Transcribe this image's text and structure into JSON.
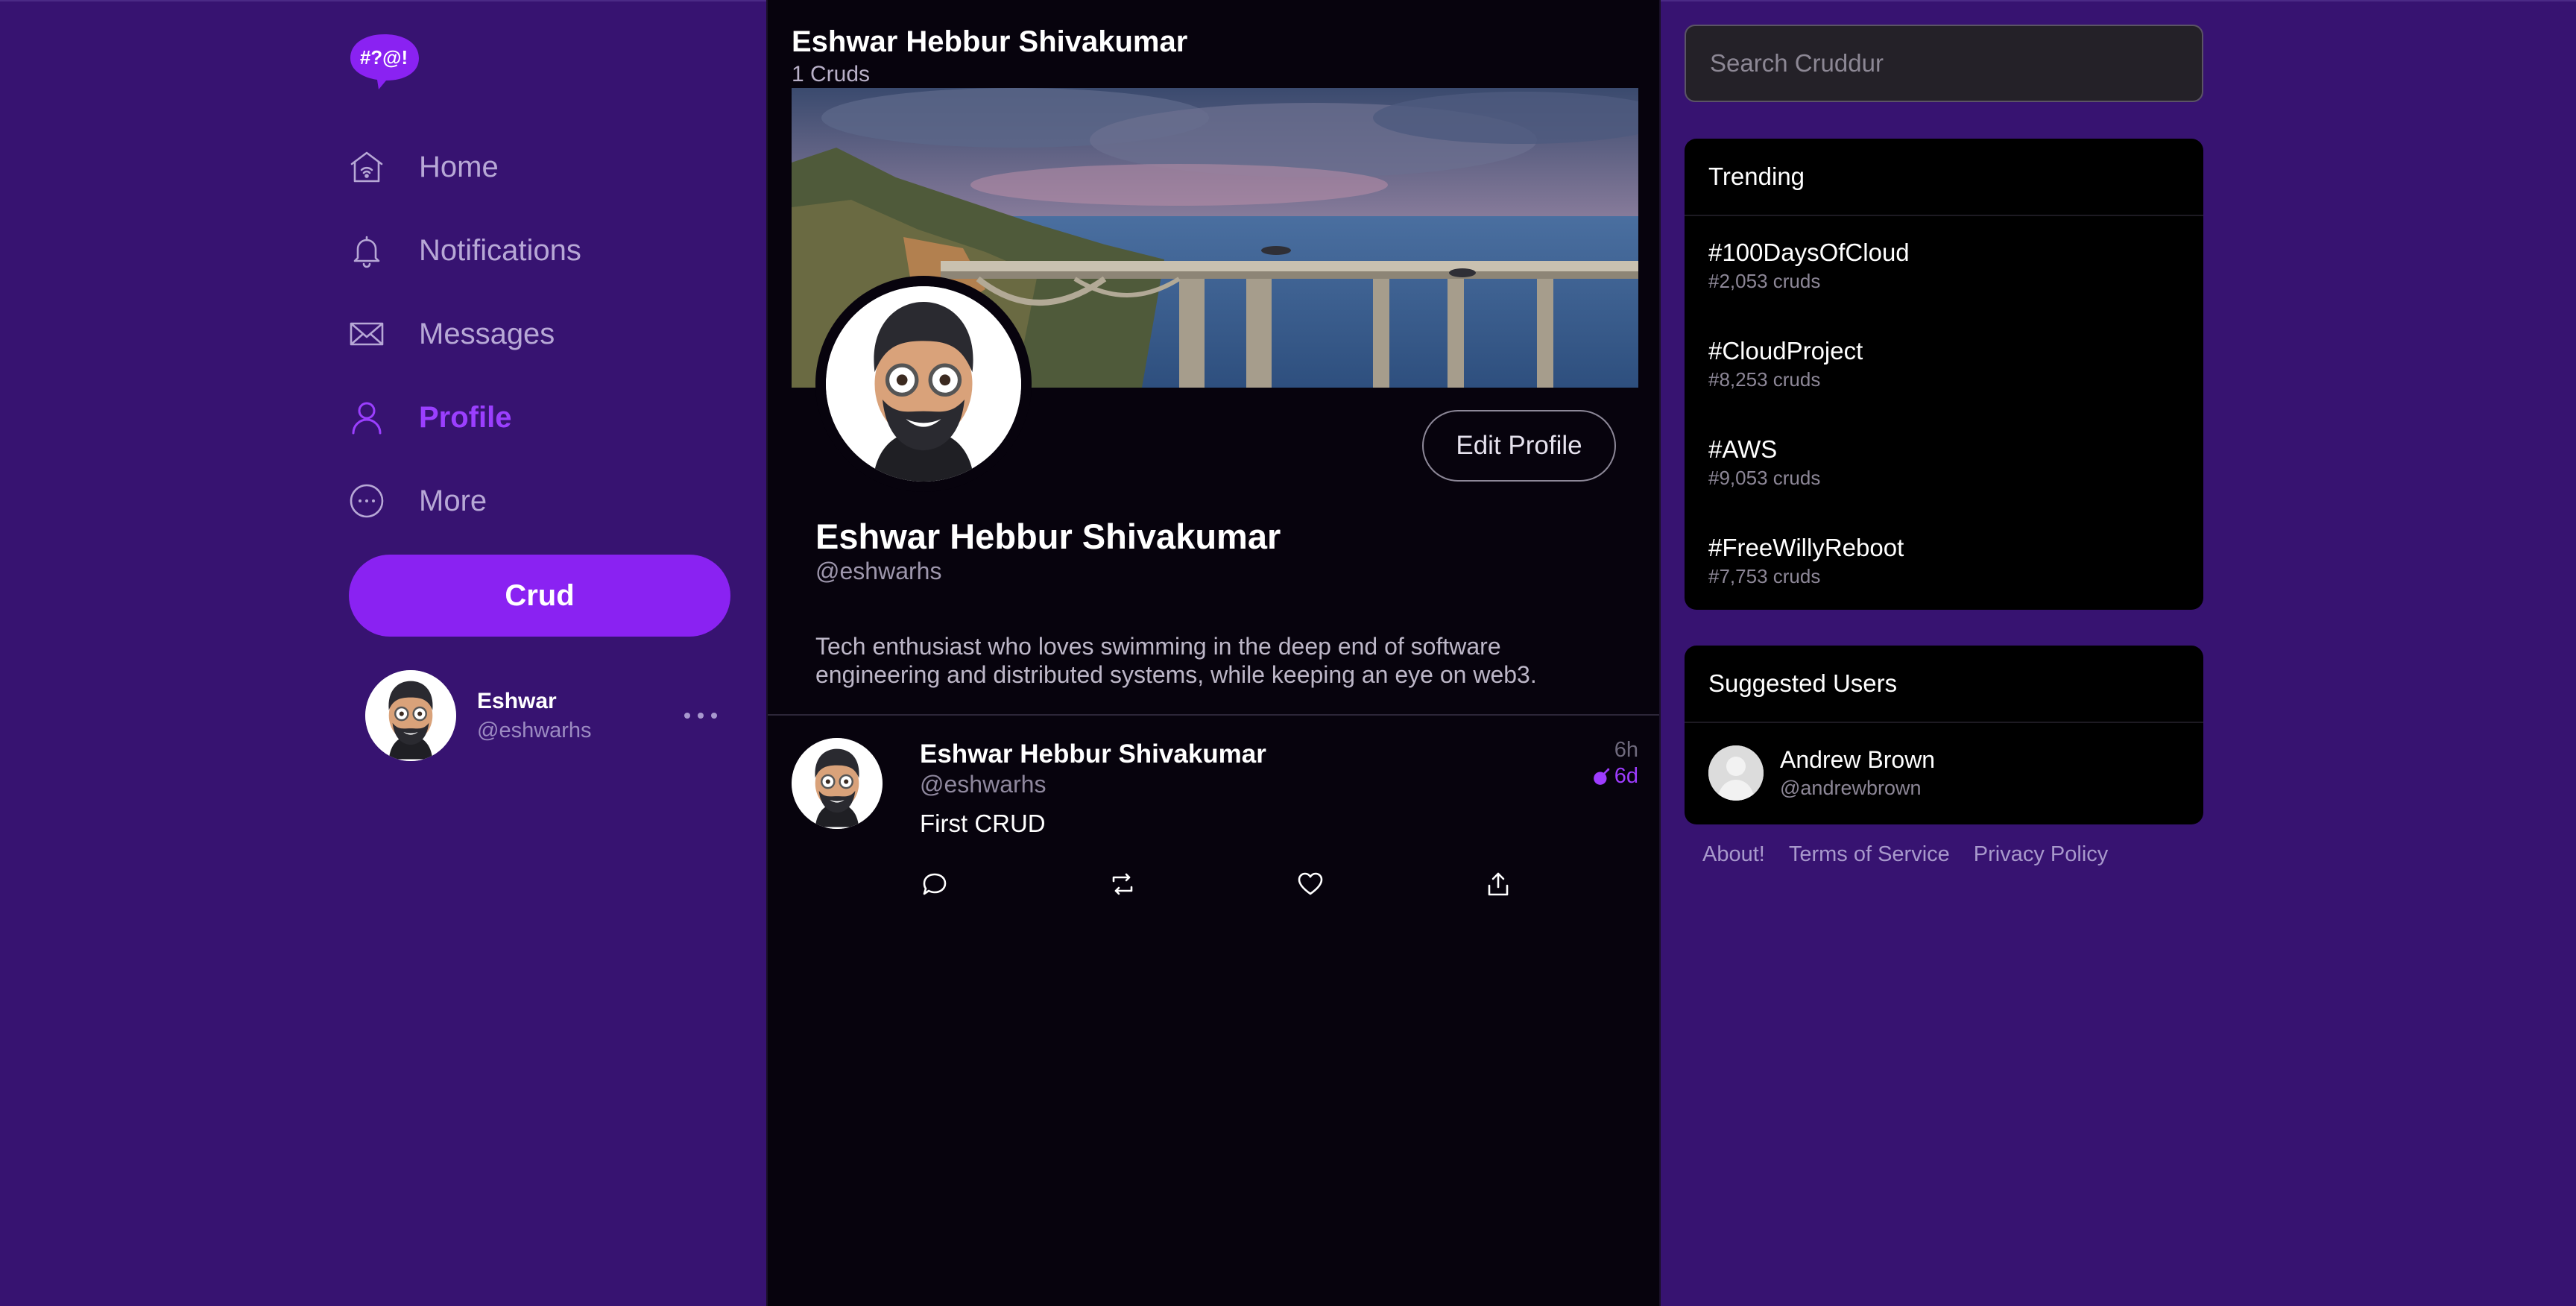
{
  "app": {
    "logo_text": "#?@!",
    "brand_color": "#8a22f2",
    "background_color": "#371371"
  },
  "sidebar": {
    "items": [
      {
        "label": "Home",
        "icon": "home-icon",
        "active": false
      },
      {
        "label": "Notifications",
        "icon": "bell-icon",
        "active": false
      },
      {
        "label": "Messages",
        "icon": "envelope-icon",
        "active": false
      },
      {
        "label": "Profile",
        "icon": "person-icon",
        "active": true
      },
      {
        "label": "More",
        "icon": "more-circle-icon",
        "active": false
      }
    ],
    "crud_button_label": "Crud",
    "current_user": {
      "name": "Eshwar",
      "handle": "@eshwarhs"
    }
  },
  "profile": {
    "header_title": "Eshwar Hebbur Shivakumar",
    "header_count": "1 Cruds",
    "display_name": "Eshwar Hebbur Shivakumar",
    "handle": "@eshwarhs",
    "bio": "Tech enthusiast who loves swimming in the deep end of software engineering and distributed systems, while keeping an eye on web3.",
    "edit_button_label": "Edit Profile"
  },
  "posts": [
    {
      "author": "Eshwar Hebbur Shivakumar",
      "handle": "@eshwarhs",
      "text": "First CRUD",
      "time": "6h",
      "expires": "6d"
    }
  ],
  "search": {
    "placeholder": "Search Cruddur"
  },
  "trending": {
    "title": "Trending",
    "items": [
      {
        "tag": "#100DaysOfCloud",
        "count": "#2,053 cruds"
      },
      {
        "tag": "#CloudProject",
        "count": "#8,253 cruds"
      },
      {
        "tag": "#AWS",
        "count": "#9,053 cruds"
      },
      {
        "tag": "#FreeWillyReboot",
        "count": "#7,753 cruds"
      }
    ]
  },
  "suggested": {
    "title": "Suggested Users",
    "users": [
      {
        "name": "Andrew Brown",
        "handle": "@andrewbrown"
      }
    ]
  },
  "footer": {
    "links": [
      "About!",
      "Terms of Service",
      "Privacy Policy"
    ]
  }
}
